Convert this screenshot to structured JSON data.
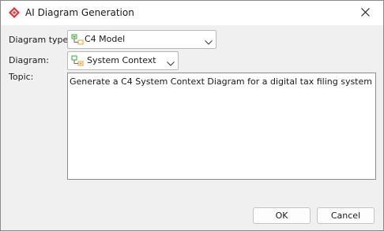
{
  "window": {
    "title": "AI Diagram Generation",
    "icons": {
      "app": "red-diamond-logo-icon",
      "close": "close-icon"
    }
  },
  "form": {
    "diagram_type": {
      "label": "Diagram type:",
      "value": "C4 Model",
      "icon": "c4-model-icon"
    },
    "diagram": {
      "label": "Diagram:",
      "value": "System Context",
      "icon": "system-context-icon"
    },
    "topic": {
      "label": "Topic:",
      "value": "Generate a C4 System Context Diagram for a digital tax filing system"
    }
  },
  "buttons": {
    "ok": "OK",
    "cancel": "Cancel"
  },
  "colors": {
    "accent": "#d9363e",
    "icon_green": "#3aa43a",
    "icon_orange": "#e8a33a"
  }
}
